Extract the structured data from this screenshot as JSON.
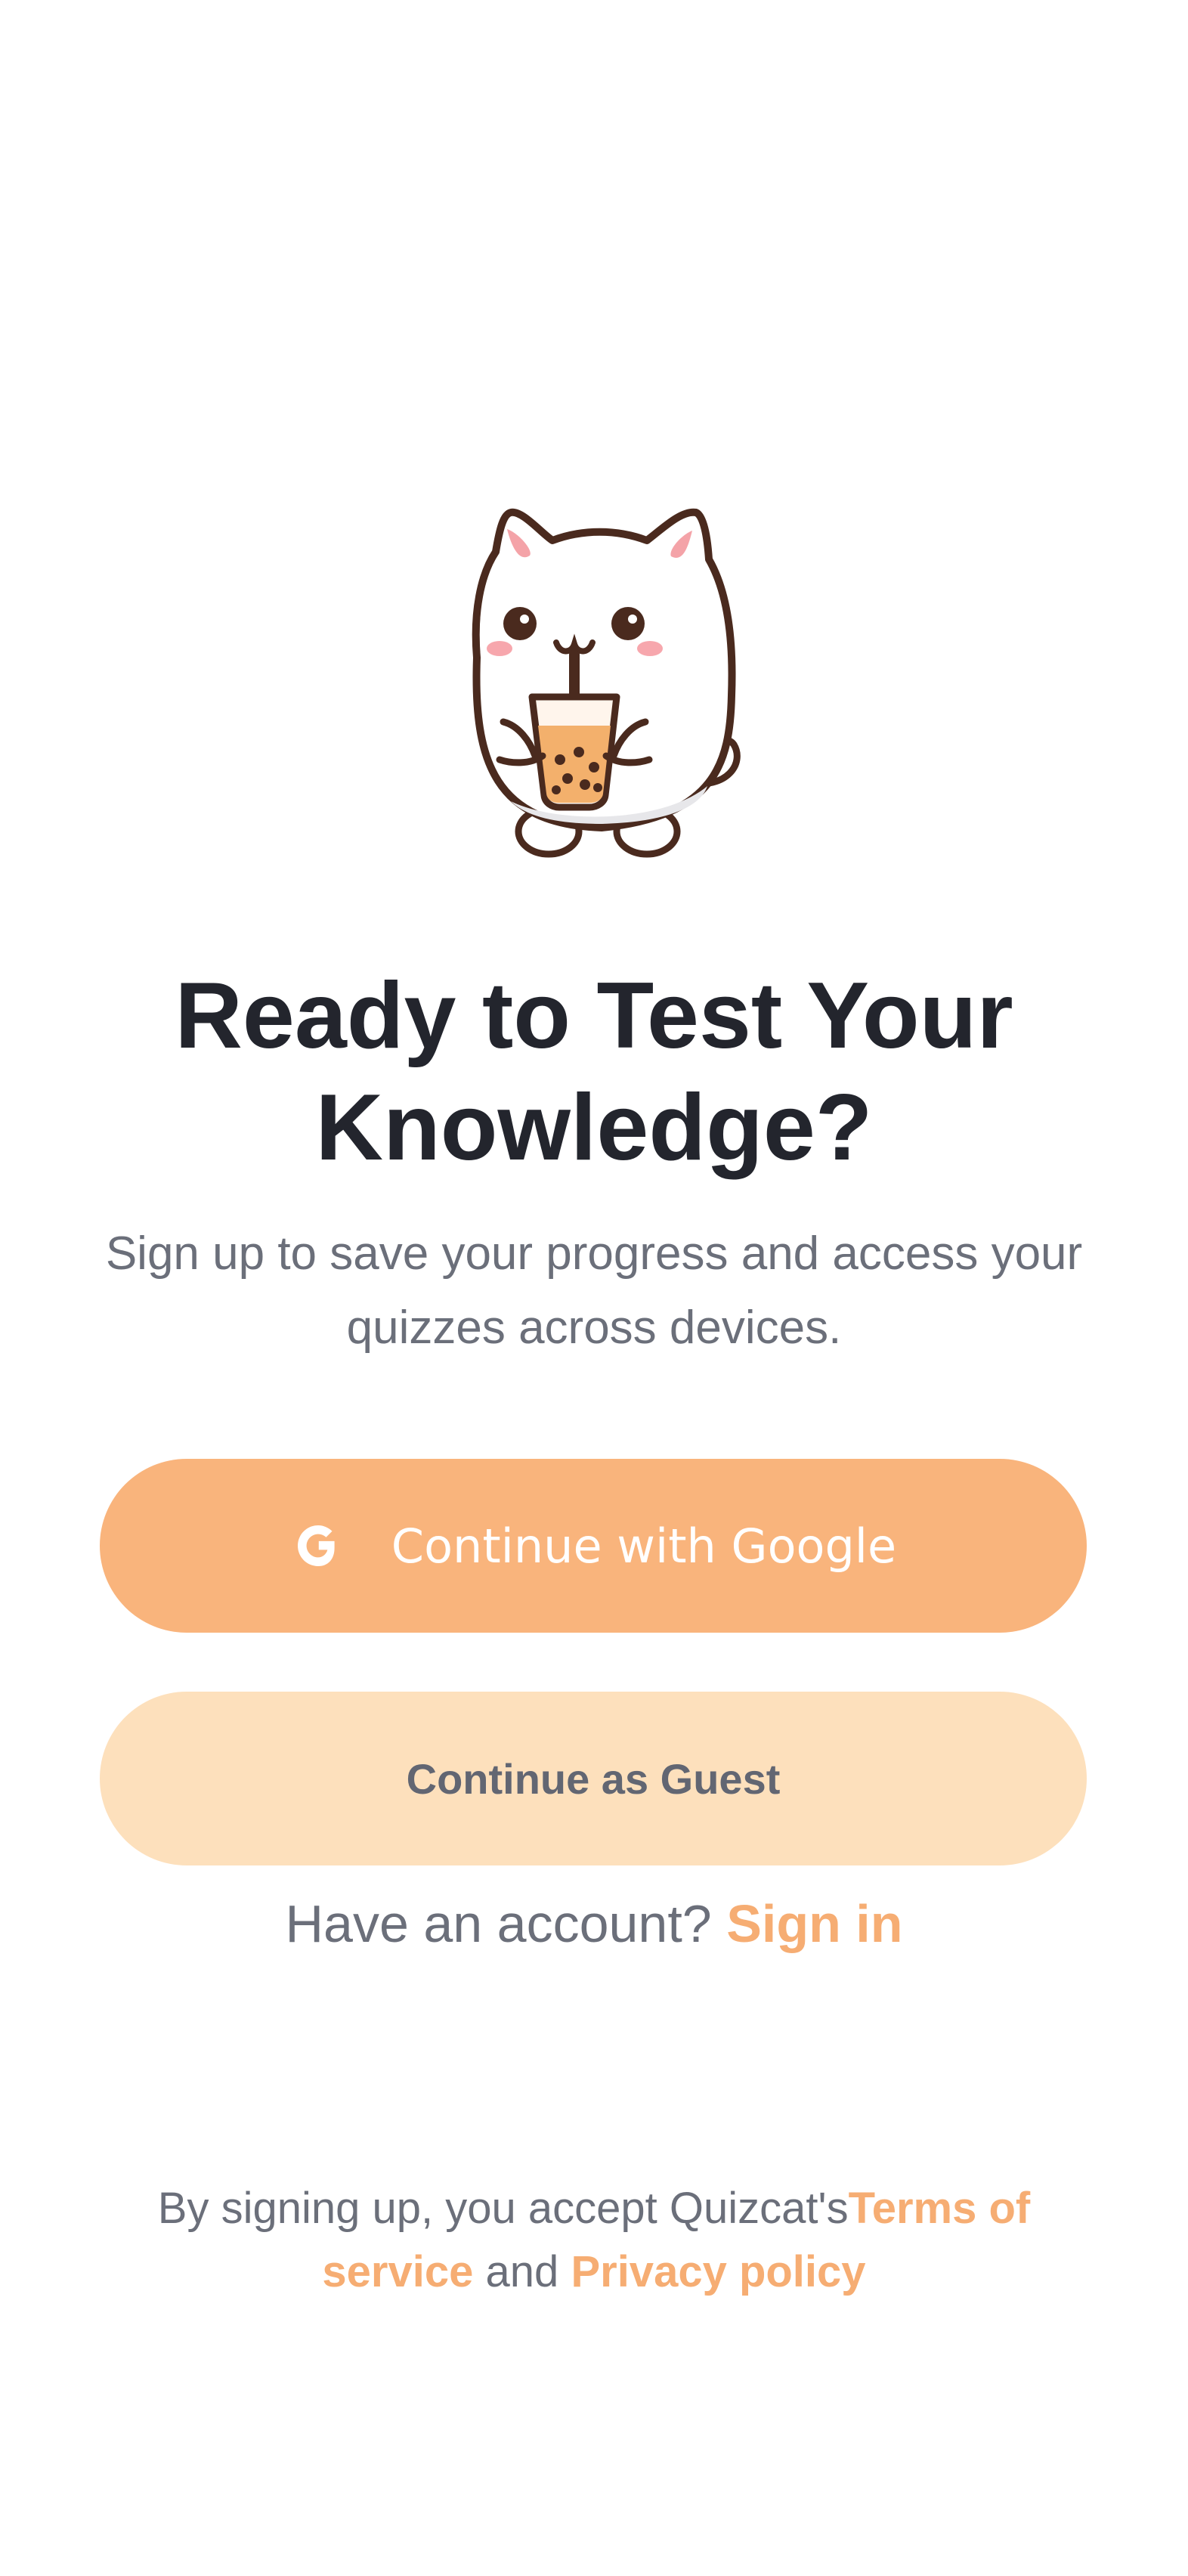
{
  "welcome": {
    "mascot_icon": "cat-drinking-boba-mascot",
    "headline_line1": "Ready to Test Your",
    "headline_line2": "Knowledge?",
    "subtitle": "Sign up to save your progress and access your quizzes across devices."
  },
  "actions": {
    "google_icon": "google-g-icon",
    "google_label": "Continue with Google",
    "guest_label": "Continue as Guest",
    "account_prompt": "Have an account?",
    "sign_in_label": "Sign in"
  },
  "legal": {
    "prefix": "By signing up, you accept Quizcat's",
    "terms_label": "Terms of service",
    "conjunction": "and",
    "privacy_label": "Privacy policy"
  },
  "colors": {
    "primary_button": "#f9b47c",
    "secondary_button": "#fde0bc",
    "link_accent": "#f6ad73",
    "headline_text": "#23252d",
    "body_text": "#6b6f7a"
  }
}
